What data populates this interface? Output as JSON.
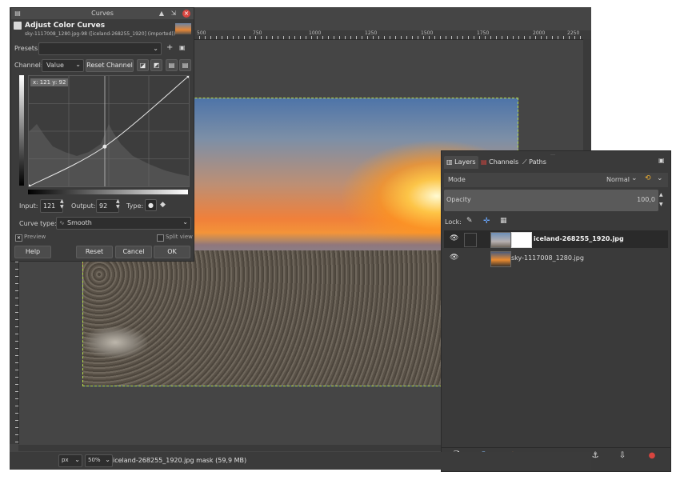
{
  "curves_dialog": {
    "window_title": "Curves",
    "heading": "Adjust Color Curves",
    "subheading": "sky-1117008_1280.jpg-98 ([iceland-268255_1920] (imported))",
    "presets_label": "Presets:",
    "channel_label": "Channel:",
    "channel_value": "Value",
    "reset_channel_label": "Reset Channel",
    "coord_readout": "x: 121 y: 92",
    "input_label": "Input:",
    "input_value": "121",
    "output_label": "Output:",
    "output_value": "92",
    "type_label": "Type:",
    "curve_type_label": "Curve type:",
    "curve_type_value": "Smooth",
    "preview_label": "Preview",
    "split_view_label": "Split view",
    "help_label": "Help",
    "reset_label": "Reset",
    "cancel_label": "Cancel",
    "ok_label": "OK",
    "curve_points": [
      [
        0,
        0
      ],
      [
        121,
        92
      ],
      [
        255,
        255
      ]
    ]
  },
  "ruler": {
    "labels": [
      "500",
      "750",
      "1000",
      "1250",
      "1500",
      "1750",
      "2000",
      "2250"
    ]
  },
  "layers_dock": {
    "tabs": [
      {
        "label": "Layers",
        "icon": "layers-icon"
      },
      {
        "label": "Channels",
        "icon": "channels-icon"
      },
      {
        "label": "Paths",
        "icon": "paths-icon"
      }
    ],
    "mode_label": "Mode",
    "mode_value": "Normal",
    "opacity_label": "Opacity",
    "opacity_value": "100,0",
    "lock_label": "Lock:",
    "layers": [
      {
        "name": "iceland-268255_1920.jpg",
        "selected": true,
        "has_mask": true
      },
      {
        "name": "sky-1117008_1280.jpg",
        "selected": false,
        "has_mask": false
      }
    ]
  },
  "status_bar": {
    "unit": "px",
    "zoom": "50%",
    "message": "iceland-268255_1920.jpg mask (59,9 MB)"
  },
  "colors": {
    "delete_accent": "#d8453f",
    "selection_outline": "#b8e04a",
    "action_orange": "#e0843a"
  }
}
